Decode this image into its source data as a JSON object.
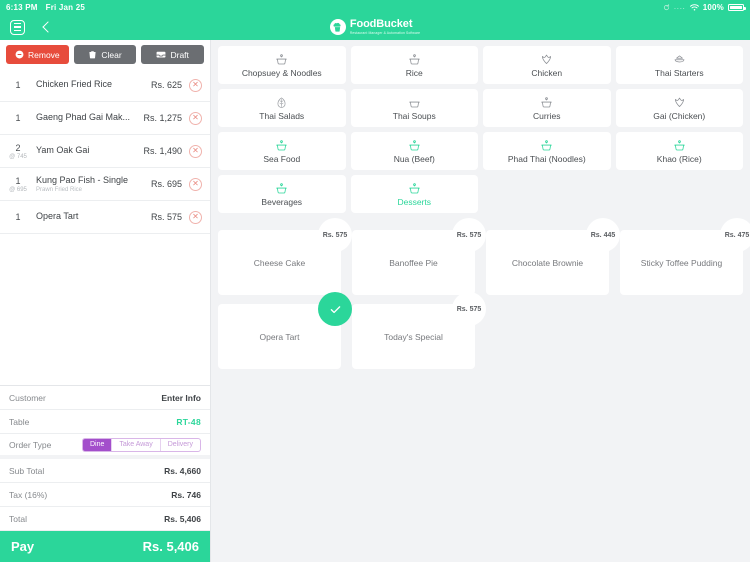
{
  "statusbar": {
    "time": "6:13 PM",
    "date": "Fri Jan 25",
    "signal_dots": "....",
    "battery_pct": "100%",
    "refresh_icon": "refresh-icon",
    "wifi_icon": "wifi-icon",
    "battery_icon": "battery-icon"
  },
  "topbar": {
    "menu_icon": "hamburger-menu-icon",
    "back_icon": "back-chevron-icon",
    "brand_name": "FoodBucket",
    "brand_tagline": "Restaurant Manager & Automation Software",
    "brand_logo_icon": "chef-hat-bucket-logo"
  },
  "colors": {
    "accent_green": "#2bd69a",
    "danger_red": "#e74c3c",
    "neutral_gray": "#6b6e72",
    "purple": "#a34fcb",
    "page_bg": "#f2f3f5"
  },
  "actions": [
    {
      "label": "Remove",
      "icon": "minus-circle-icon",
      "style": "danger"
    },
    {
      "label": "Clear",
      "icon": "trash-icon",
      "style": "neutral"
    },
    {
      "label": "Draft",
      "icon": "inbox-icon",
      "style": "neutral"
    }
  ],
  "cart": {
    "items": [
      {
        "qty": "1",
        "at": "",
        "name": "Chicken Fried Rice",
        "sub": "",
        "price": "Rs. 625"
      },
      {
        "qty": "1",
        "at": "",
        "name": "Gaeng Phad Gai Mak...",
        "sub": "",
        "price": "Rs. 1,275"
      },
      {
        "qty": "2",
        "at": "@ 745",
        "name": "Yam Oak Gai",
        "sub": "",
        "price": "Rs. 1,490"
      },
      {
        "qty": "1",
        "at": "@ 695",
        "name": "Kung Pao Fish - Single",
        "sub": "Prawn Fried Rice",
        "price": "Rs. 695"
      },
      {
        "qty": "1",
        "at": "",
        "name": "Opera Tart",
        "sub": "",
        "price": "Rs. 575"
      }
    ],
    "remove_icon": "remove-item-x-icon"
  },
  "summary": {
    "customer_label": "Customer",
    "customer_value": "Enter Info",
    "table_label": "Table",
    "table_value": "RT-48",
    "order_type_label": "Order Type",
    "order_types": [
      {
        "label": "Dine",
        "selected": true
      },
      {
        "label": "Take Away",
        "selected": false
      },
      {
        "label": "Delivery",
        "selected": false
      }
    ],
    "subtotal_label": "Sub Total",
    "subtotal_value": "Rs. 4,660",
    "tax_label": "Tax (16%)",
    "tax_value": "Rs. 746",
    "total_label": "Total",
    "total_value": "Rs. 5,406",
    "pay_label": "Pay",
    "pay_value": "Rs. 5,406"
  },
  "categories": [
    {
      "label": "Chopsuey & Noodles",
      "icon": "pot-icon",
      "active": false
    },
    {
      "label": "Rice",
      "icon": "pot-icon",
      "active": false
    },
    {
      "label": "Chicken",
      "icon": "chicken-icon",
      "active": false
    },
    {
      "label": "Thai Starters",
      "icon": "plate-stack-icon",
      "active": false
    },
    {
      "label": "Thai Salads",
      "icon": "leaf-icon",
      "active": false
    },
    {
      "label": "Thai Soups",
      "icon": "bowl-icon",
      "active": false
    },
    {
      "label": "Curries",
      "icon": "pot-icon",
      "active": false
    },
    {
      "label": "Gai (Chicken)",
      "icon": "chicken-icon",
      "active": false
    },
    {
      "label": "Sea Food",
      "icon": "pot-icon",
      "active": false
    },
    {
      "label": "Nua (Beef)",
      "icon": "pot-icon",
      "active": false
    },
    {
      "label": "Phad Thai (Noodles)",
      "icon": "pot-icon",
      "active": false
    },
    {
      "label": "Khao (Rice)",
      "icon": "pot-icon",
      "active": false
    },
    {
      "label": "Beverages",
      "icon": "pot-icon",
      "active": false
    },
    {
      "label": "Desserts",
      "icon": "pot-icon",
      "active": true
    }
  ],
  "products": [
    {
      "name": "Cheese Cake",
      "price": "Rs. 575",
      "selected": false
    },
    {
      "name": "Banoffee Pie",
      "price": "Rs. 575",
      "selected": false
    },
    {
      "name": "Chocolate Brownie",
      "price": "Rs. 445",
      "selected": false
    },
    {
      "name": "Sticky Toffee Pudding",
      "price": "Rs. 475",
      "selected": false
    },
    {
      "name": "Opera Tart",
      "price": "",
      "selected": true
    },
    {
      "name": "Today's Special",
      "price": "Rs. 575",
      "selected": false
    }
  ]
}
